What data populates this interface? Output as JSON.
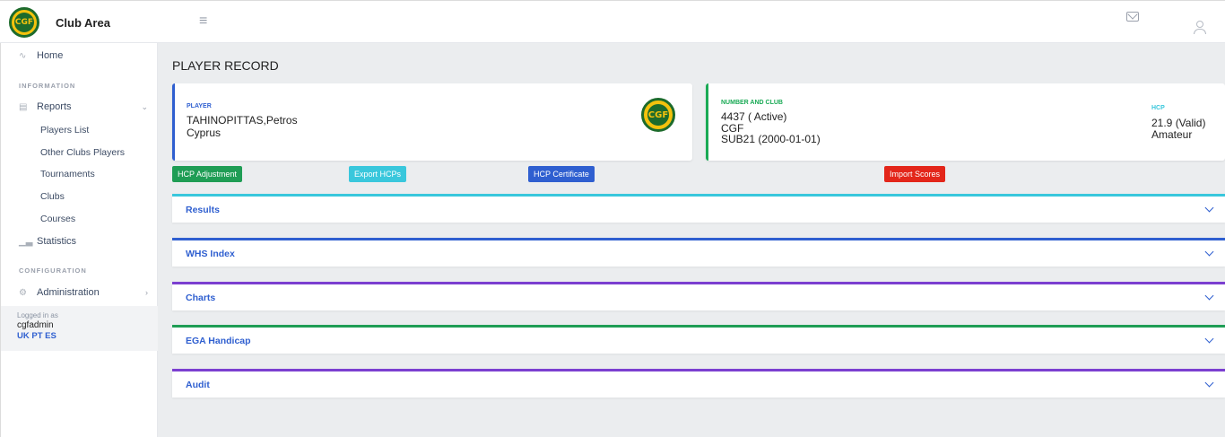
{
  "header": {
    "logo_text": "CGF",
    "app_title": "Club Area"
  },
  "sidebar": {
    "home": "Home",
    "section_information": "INFORMATION",
    "reports": "Reports",
    "reports_items": [
      "Players List",
      "Other Clubs Players",
      "Tournaments",
      "Clubs",
      "Courses"
    ],
    "statistics": "Statistics",
    "section_configuration": "CONFIGURATION",
    "administration": "Administration",
    "logged_in_label": "Logged in as",
    "username": "cgfadmin",
    "languages": "UK PT ES"
  },
  "main": {
    "page_title": "PLAYER RECORD",
    "player_card": {
      "label": "PLAYER",
      "name": "TAHINOPITTAS,Petros",
      "country": "Cyprus"
    },
    "number_card": {
      "label": "NUMBER AND CLUB",
      "number": "4437 ( Active)",
      "club": "CGF",
      "category": "SUB21 (2000-01-01)",
      "hcp_label": "HCP",
      "hcp_value": "21.9 (Valid)",
      "hcp_status": "Amateur"
    },
    "buttons": {
      "hcp_adjustment": "HCP Adjustment",
      "export_hcps": "Export HCPs",
      "hcp_certificate": "HCP Certificate",
      "import_scores": "Import Scores"
    },
    "sections": [
      "Results",
      "WHS Index",
      "Charts",
      "EGA Handicap",
      "Audit"
    ]
  },
  "colors": {
    "primary": "#2f5fd0",
    "success": "#1f9d55",
    "info": "#39c7dc",
    "danger": "#e3261a",
    "purple": "#7b3fd0"
  }
}
